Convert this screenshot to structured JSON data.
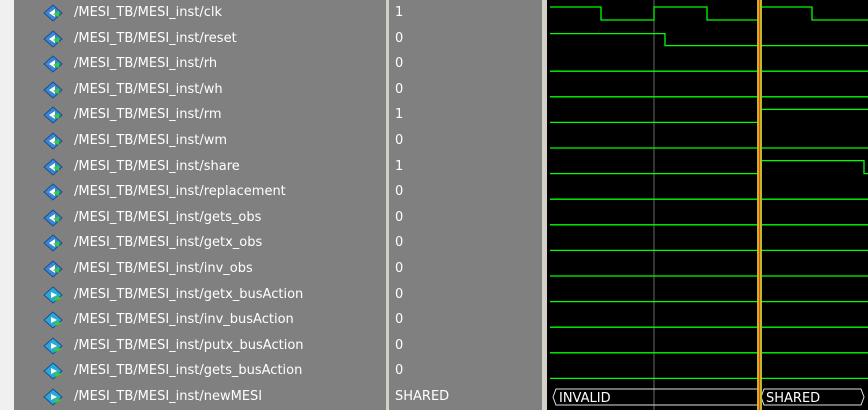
{
  "colors": {
    "pane_bg": "#808080",
    "wave_bg": "#000000",
    "signal": "#00ff00",
    "cursor": "#c8c030",
    "cursor_edge": "#ff4000",
    "text": "#ffffff"
  },
  "signals": [
    {
      "name": "/MESI_TB/MESI_inst/clk",
      "value": "1",
      "icon": "input-arrow-icon"
    },
    {
      "name": "/MESI_TB/MESI_inst/reset",
      "value": "0",
      "icon": "input-arrow-icon"
    },
    {
      "name": "/MESI_TB/MESI_inst/rh",
      "value": "0",
      "icon": "input-arrow-icon"
    },
    {
      "name": "/MESI_TB/MESI_inst/wh",
      "value": "0",
      "icon": "input-arrow-icon"
    },
    {
      "name": "/MESI_TB/MESI_inst/rm",
      "value": "1",
      "icon": "input-arrow-icon"
    },
    {
      "name": "/MESI_TB/MESI_inst/wm",
      "value": "0",
      "icon": "input-arrow-icon"
    },
    {
      "name": "/MESI_TB/MESI_inst/share",
      "value": "1",
      "icon": "input-arrow-icon"
    },
    {
      "name": "/MESI_TB/MESI_inst/replacement",
      "value": "0",
      "icon": "input-arrow-icon"
    },
    {
      "name": "/MESI_TB/MESI_inst/gets_obs",
      "value": "0",
      "icon": "input-arrow-icon"
    },
    {
      "name": "/MESI_TB/MESI_inst/getx_obs",
      "value": "0",
      "icon": "input-arrow-icon"
    },
    {
      "name": "/MESI_TB/MESI_inst/inv_obs",
      "value": "0",
      "icon": "input-arrow-icon"
    },
    {
      "name": "/MESI_TB/MESI_inst/getx_busAction",
      "value": "0",
      "icon": "output-arrow-icon"
    },
    {
      "name": "/MESI_TB/MESI_inst/inv_busAction",
      "value": "0",
      "icon": "output-arrow-icon"
    },
    {
      "name": "/MESI_TB/MESI_inst/putx_busAction",
      "value": "0",
      "icon": "output-arrow-icon"
    },
    {
      "name": "/MESI_TB/MESI_inst/gets_busAction",
      "value": "0",
      "icon": "output-arrow-icon"
    },
    {
      "name": "/MESI_TB/MESI_inst/newMESI",
      "value": "SHARED",
      "icon": "output-arrow-icon"
    }
  ],
  "bus_labels": {
    "before": "INVALID",
    "after": "SHARED"
  }
}
